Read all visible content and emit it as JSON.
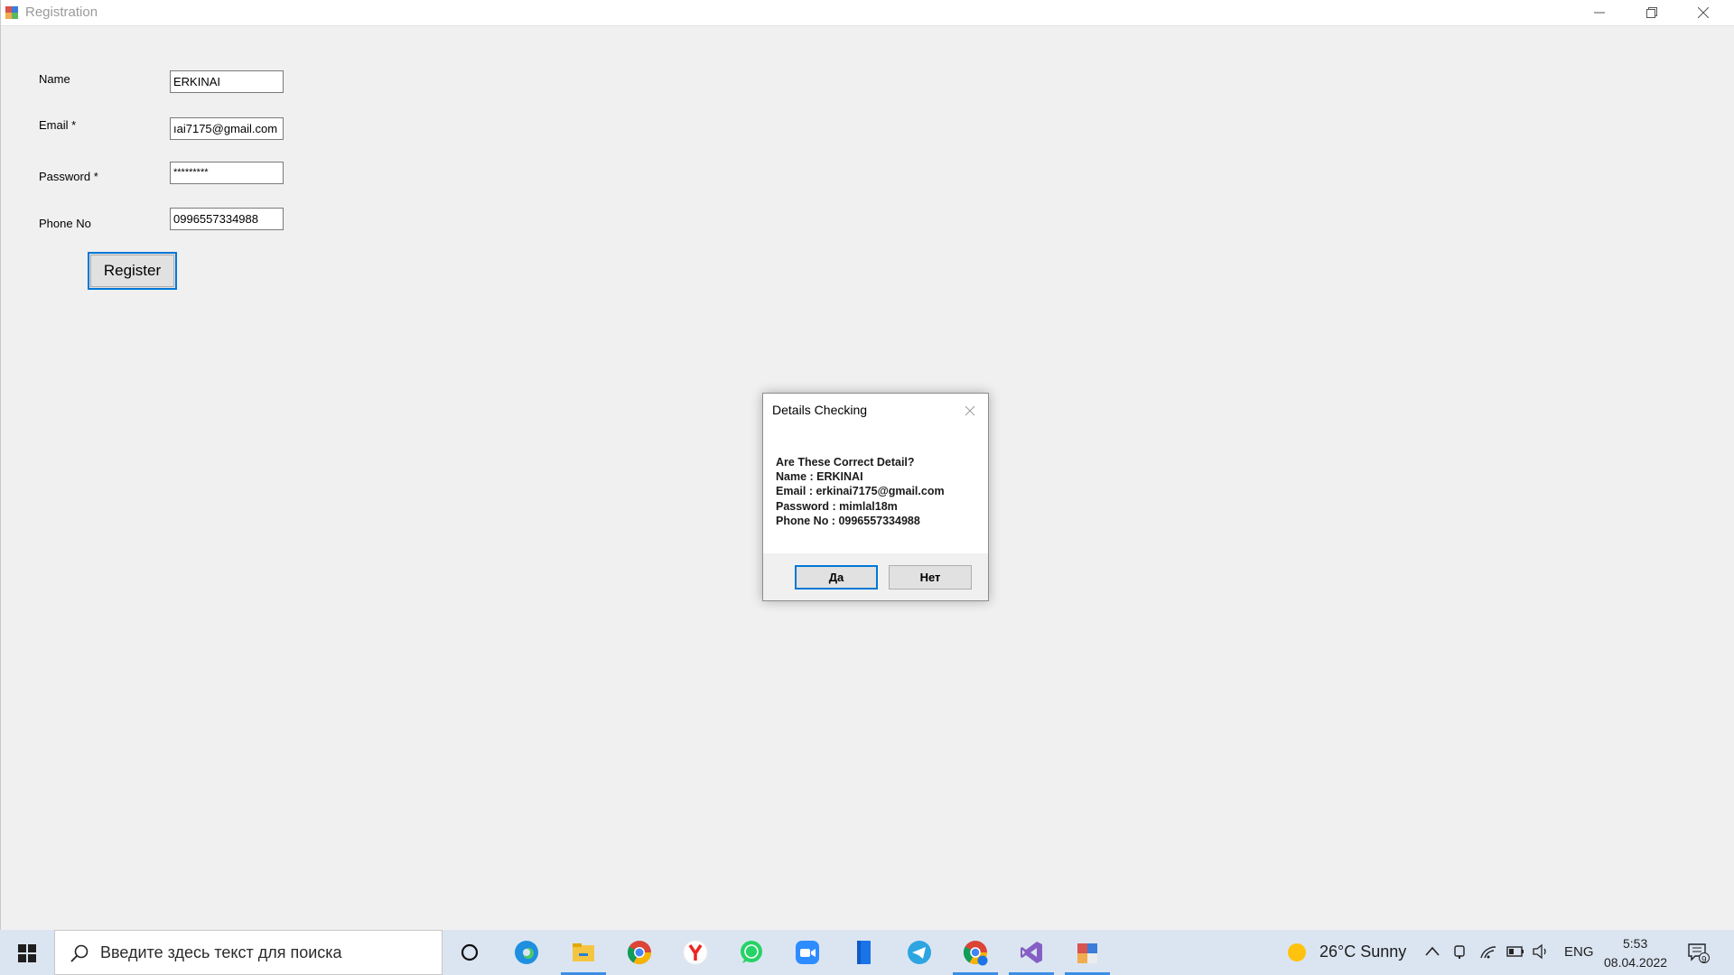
{
  "window": {
    "title": "Registration"
  },
  "form": {
    "name_label": "Name",
    "name_value": "ERKINAI",
    "email_label": "Email *",
    "email_value": "ıai7175@gmail.com",
    "password_label": "Password *",
    "password_value": "*********",
    "phone_label": "Phone No",
    "phone_value": "0996557334988",
    "register_label": "Register"
  },
  "dialog": {
    "title": "Details Checking",
    "lines": [
      "Are These Correct Detail?",
      "Name : ERKINAI",
      "Email : erkinai7175@gmail.com",
      "Password : mimlal18m",
      "Phone No : 0996557334988"
    ],
    "yes_label": "Да",
    "no_label": "Нет"
  },
  "taskbar": {
    "search_placeholder": "Введите здесь текст для поиска",
    "apps": [
      "cortana-icon",
      "edge-icon",
      "file-explorer-icon",
      "chrome-icon",
      "yandex-icon",
      "whatsapp-icon",
      "zoom-icon",
      "notes-app-icon",
      "telegram-icon",
      "chrome-profile-icon",
      "visual-studio-icon",
      "registration-app-icon"
    ],
    "weather": "26°C  Sunny",
    "language": "ENG",
    "time": "5:53",
    "date": "08.04.2022",
    "notification_count": "9"
  },
  "colors": {
    "accent": "#0078d7",
    "taskbar": "#dbe5f1",
    "window_bg": "#f0f0f0"
  }
}
